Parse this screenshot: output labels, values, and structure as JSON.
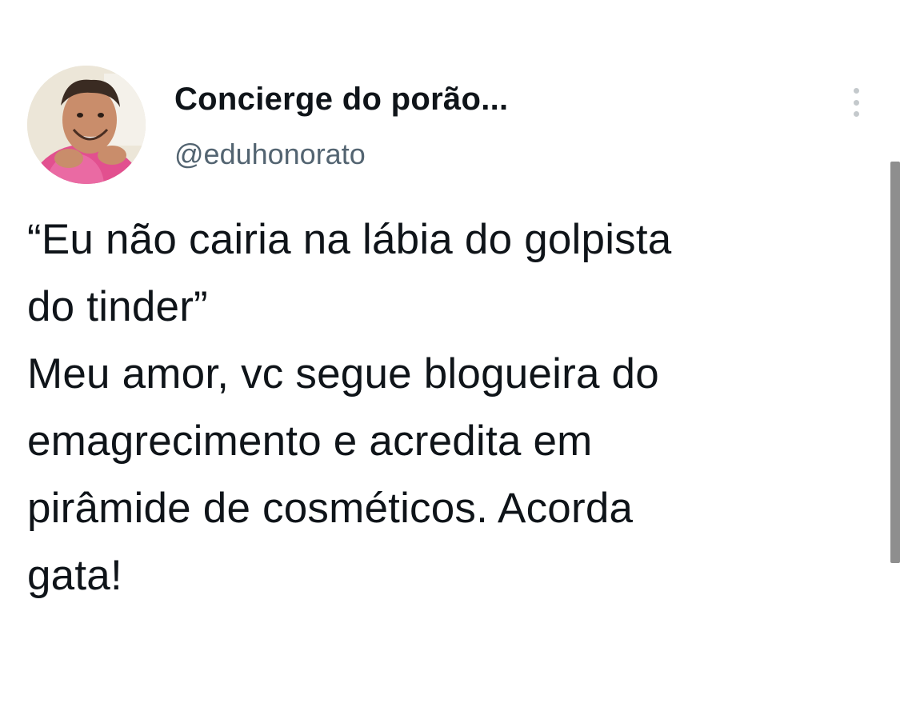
{
  "tweet": {
    "display_name": "Concierge do porão...",
    "handle": "@eduhonorato",
    "text_lines": [
      "“Eu não cairia na lábia do golpista",
      "do tinder”",
      "Meu amor, vc segue blogueira do",
      "emagrecimento e acredita em",
      "pirâmide de cosméticos. Acorda",
      "gata!"
    ]
  },
  "icons": {
    "more": "more-vertical-icon",
    "avatar": "profile-photo"
  },
  "colors": {
    "text": "#0f1419",
    "secondary_text": "#536471",
    "background": "#ffffff"
  }
}
